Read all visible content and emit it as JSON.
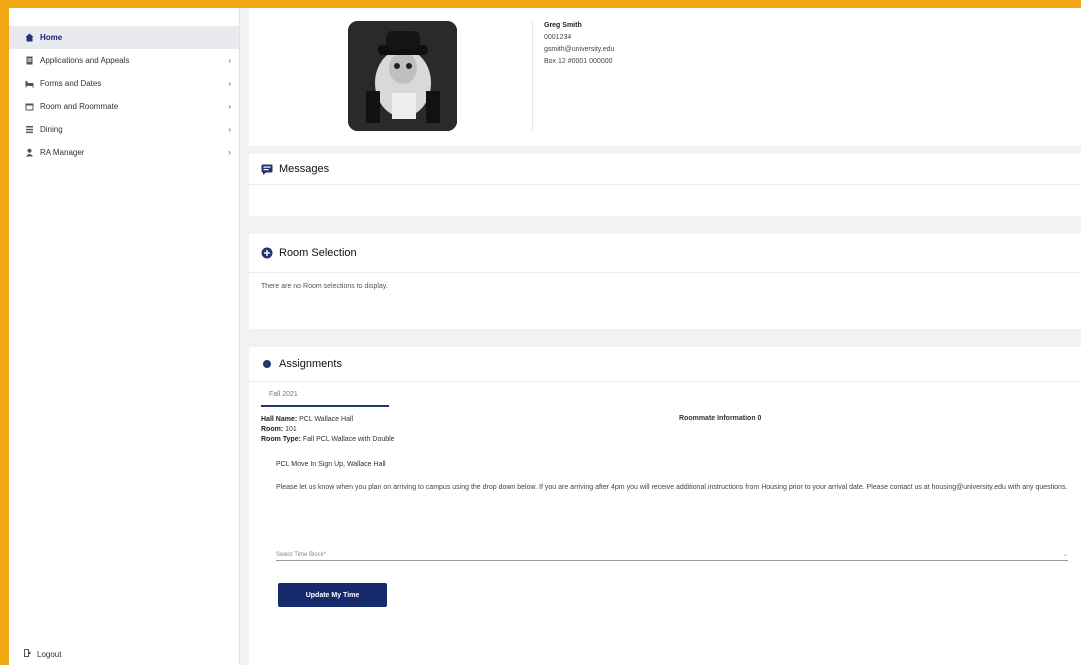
{
  "colors": {
    "accent": "#f2a814",
    "primary": "#15296b"
  },
  "sidebar": {
    "items": [
      {
        "icon": "home-icon",
        "label": "Home",
        "active": true,
        "chevron": false
      },
      {
        "icon": "document-icon",
        "label": "Applications and Appeals",
        "active": false,
        "chevron": true
      },
      {
        "icon": "bed-icon",
        "label": "Forms and Dates",
        "active": false,
        "chevron": true
      },
      {
        "icon": "calendar-icon",
        "label": "Room and Roommate",
        "active": false,
        "chevron": true
      },
      {
        "icon": "list-icon",
        "label": "Dining",
        "active": false,
        "chevron": true
      },
      {
        "icon": "user-icon",
        "label": "RA Manager",
        "active": false,
        "chevron": true
      }
    ],
    "logout_label": "Logout"
  },
  "profile": {
    "name": "Greg Smith",
    "id": "0001234",
    "email": "gsmith@university.edu",
    "box": "Box 12 #0001 000000"
  },
  "messages": {
    "title": "Messages"
  },
  "room_selection": {
    "title": "Room Selection",
    "body": "There are no Room selections to display."
  },
  "assignments": {
    "title": "Assignments",
    "tab_label": "Fall 2021",
    "hall_label": "Hall Name:",
    "hall_value": "PCL Wallace Hall",
    "room_label": "Room:",
    "room_value": "101",
    "roomtype_label": "Room Type:",
    "roomtype_value": "Fall PCL Wallace with Double",
    "roommate_label": "Roommate Information 0",
    "message_title": "PCL Move In Sign Up, Wallace Hall",
    "message_body": "Please let us know when you plan on arriving to campus using the drop down below. If you are arriving after 4pm you will receive additional instructions from Housing prior to your arrival date. Please contact us at housing@university.edu with any questions.",
    "select_placeholder": "Select Time Block*",
    "select_arrow": "⌄",
    "update_button": "Update My Time"
  }
}
